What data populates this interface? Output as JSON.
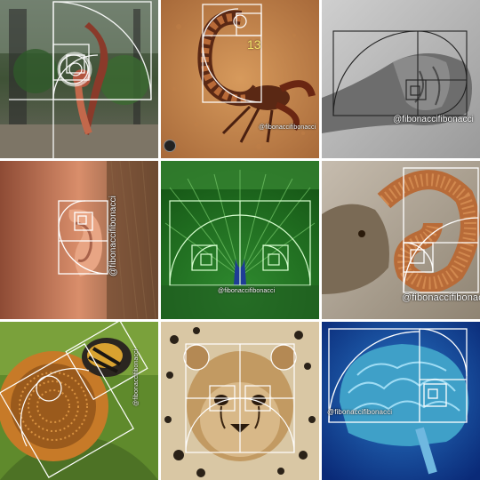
{
  "watermark": "@fibonaccifibonacci",
  "spiral_number": "13",
  "tiles": [
    {
      "subject": "yoga-pose"
    },
    {
      "subject": "scorpion"
    },
    {
      "subject": "fist"
    },
    {
      "subject": "ear"
    },
    {
      "subject": "peacock"
    },
    {
      "subject": "ram-horn"
    },
    {
      "subject": "flower-and-bee"
    },
    {
      "subject": "cheetah-cub"
    },
    {
      "subject": "brain"
    }
  ],
  "colors": {
    "overlay_white": "#ffffff",
    "overlay_gold": "#e9c36a",
    "overlay_green": "#cfffc4"
  }
}
